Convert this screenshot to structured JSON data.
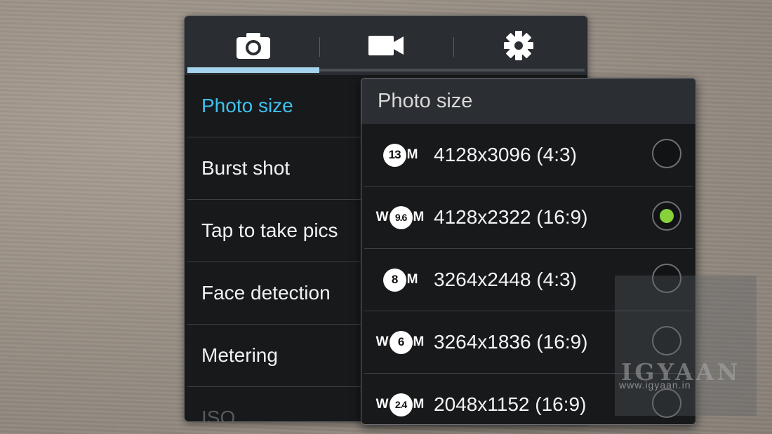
{
  "tabs": [
    {
      "icon": "camera-icon",
      "active": true
    },
    {
      "icon": "video-camera-icon",
      "active": false
    },
    {
      "icon": "gear-icon",
      "active": false
    }
  ],
  "menu": {
    "items": [
      {
        "label": "Photo size",
        "active": true
      },
      {
        "label": "Burst shot"
      },
      {
        "label": "Tap to take pics"
      },
      {
        "label": "Face detection"
      },
      {
        "label": "Metering"
      },
      {
        "label": "ISO"
      }
    ]
  },
  "dialog": {
    "title": "Photo size",
    "options": [
      {
        "badge_prefix": "",
        "badge_value": "13",
        "badge_suffix": "M",
        "label": "4128x3096 (4:3)",
        "selected": false
      },
      {
        "badge_prefix": "W",
        "badge_value": "9.6",
        "badge_suffix": "M",
        "label": "4128x2322 (16:9)",
        "selected": true
      },
      {
        "badge_prefix": "",
        "badge_value": "8",
        "badge_suffix": "M",
        "label": "3264x2448 (4:3)",
        "selected": false
      },
      {
        "badge_prefix": "W",
        "badge_value": "6",
        "badge_suffix": "M",
        "label": "3264x1836 (16:9)",
        "selected": false
      },
      {
        "badge_prefix": "W",
        "badge_value": "2.4",
        "badge_suffix": "M",
        "label": "2048x1152 (16:9)",
        "selected": false
      }
    ]
  },
  "watermark": {
    "logo": "IGYAAN",
    "url": "www.igyaan.in"
  },
  "colors": {
    "accent": "#3fc1ee",
    "tab_active": "#a6d4ec",
    "radio_selected": "#87d23a"
  }
}
